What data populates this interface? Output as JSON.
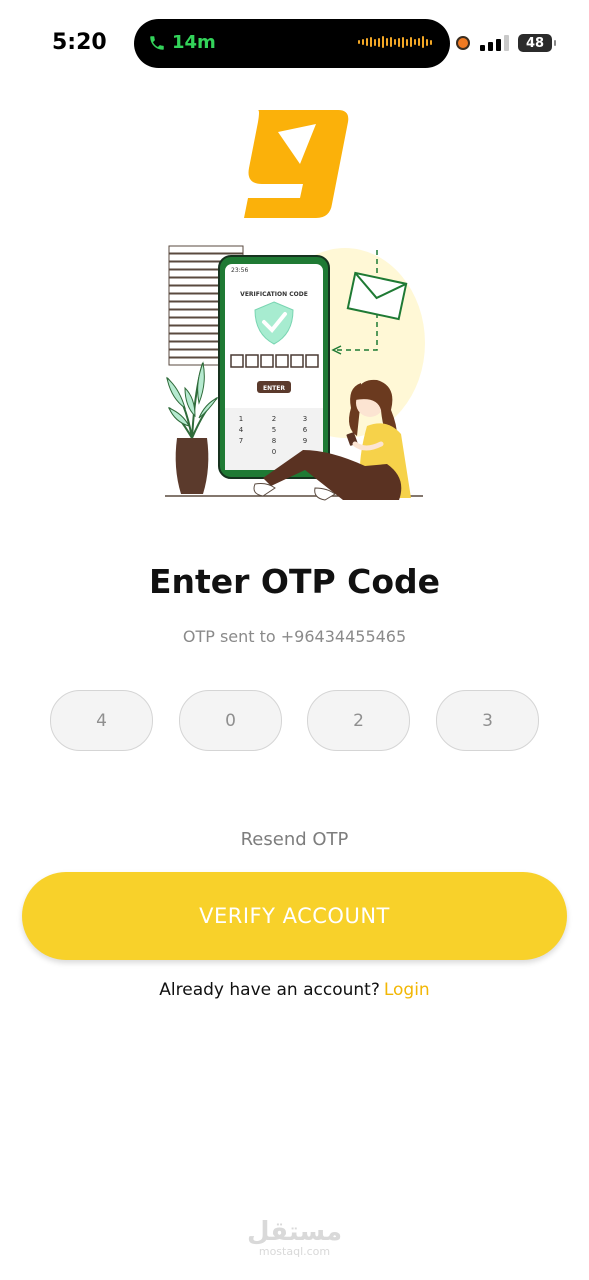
{
  "status_bar": {
    "time": "5:20",
    "call_duration": "14m",
    "battery": "48"
  },
  "app": {
    "brand_color": "#FBB10A",
    "accent_color": "#F8D12A"
  },
  "illustration": {
    "phone_time": "23:56",
    "phone_heading": "VERIFICATION CODE",
    "phone_enter": "ENTER",
    "keypad": [
      "1",
      "2",
      "3",
      "4",
      "5",
      "6",
      "7",
      "8",
      "9",
      "0"
    ]
  },
  "screen": {
    "title": "Enter OTP Code",
    "subtitle": "OTP sent to +96434455465",
    "otp_digits": [
      "4",
      "0",
      "2",
      "3"
    ],
    "resend": "Resend OTP",
    "verify_button": "VERIFY ACCOUNT",
    "login_prompt": "Already have an account?",
    "login_link": "Login"
  },
  "watermark": {
    "main": "مستقل",
    "sub": "mostaql.com"
  }
}
